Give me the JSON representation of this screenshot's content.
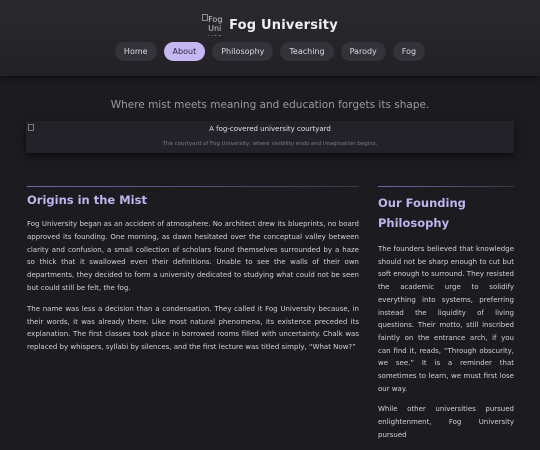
{
  "site": {
    "title": "Fog University",
    "logo_alt": "Fog University"
  },
  "nav": {
    "items": [
      "Home",
      "About",
      "Philosophy",
      "Teaching",
      "Parody",
      "Fog"
    ],
    "active": "About"
  },
  "tagline": "Where mist meets meaning and education forgets its shape.",
  "figure": {
    "alt": "A fog-covered university courtyard",
    "caption": "The courtyard of Fog University, where visibility ends and imagination begins."
  },
  "origins": {
    "heading": "Origins in the Mist",
    "paragraphs": [
      "Fog University began as an accident of atmosphere. No architect drew its blueprints, no board approved its founding. One morning, as dawn hesitated over the conceptual valley between clarity and confusion, a small collection of scholars found themselves surrounded by a haze so thick that it swallowed even their definitions. Unable to see the walls of their own departments, they decided to form a university dedicated to studying what could not be seen but could still be felt, the fog.",
      "The name was less a decision than a condensation. They called it Fog University because, in their words, it was already there. Like most natural phenomena, its existence preceded its explanation. The first classes took place in borrowed rooms filled with uncertainty. Chalk was replaced by whispers, syllabi by silences, and the first lecture was titled simply, “What Now?”"
    ]
  },
  "philosophy": {
    "heading": "Our Founding Philosophy",
    "paragraphs": [
      "The founders believed that knowledge should not be sharp enough to cut but soft enough to surround. They resisted the academic urge to solidify everything into systems, preferring instead the liquidity of living questions. Their motto, still inscribed faintly on the entrance arch, if you can find it, reads, “Through obscurity, we see.” It is a reminder that sometimes to learn, we must first lose our way.",
      "While other universities pursued enlightenment, Fog University pursued"
    ]
  }
}
